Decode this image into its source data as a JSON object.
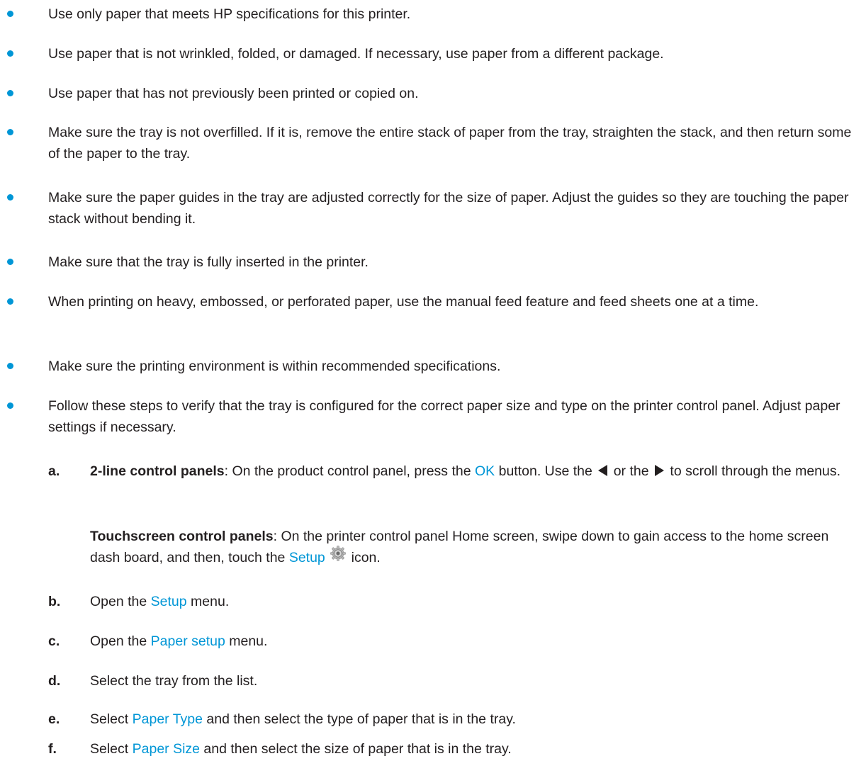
{
  "bullets": [
    "Use only paper that meets HP specifications for this printer.",
    "Use paper that is not wrinkled, folded, or damaged. If necessary, use paper from a different package.",
    "Use paper that has not previously been printed or copied on.",
    "Make sure the tray is not overfilled. If it is, remove the entire stack of paper from the tray, straighten the stack, and then return some of the paper to the tray.",
    "Make sure the paper guides in the tray are adjusted correctly for the size of paper. Adjust the guides so they are touching the paper stack without bending it.",
    "Make sure that the tray is fully inserted in the printer.",
    "When printing on heavy, embossed, or perforated paper, use the manual feed feature and feed sheets one at a time.",
    "Make sure the printing environment is within recommended specifications.",
    "Follow these steps to verify that the tray is configured for the correct paper size and type on the printer control panel. Adjust paper settings if necessary."
  ],
  "steps": {
    "a": {
      "letter": "a.",
      "twoline_label": "2-line control panels",
      "twoline_text1": ": On the product control panel, press the ",
      "ok": "OK",
      "twoline_text2": " button. Use the ",
      "twoline_text3": " or the ",
      "twoline_text4": " to scroll through the menus.",
      "touch_label": "Touchscreen control panels",
      "touch_text1": ": On the printer control panel Home screen, swipe down to gain access to the home screen dash board, and then, touch the ",
      "setup": "Setup",
      "touch_text2": " icon."
    },
    "b": {
      "letter": "b.",
      "pre": "Open the ",
      "link": "Setup",
      "post": " menu."
    },
    "c": {
      "letter": "c.",
      "pre": "Open the ",
      "link": "Paper setup",
      "post": " menu."
    },
    "d": {
      "letter": "d.",
      "text": "Select the tray from the list."
    },
    "e": {
      "letter": "e.",
      "pre": "Select ",
      "link": "Paper Type",
      "post": " and then select the type of paper that is in the tray."
    },
    "f": {
      "letter": "f.",
      "pre": "Select ",
      "link": "Paper Size",
      "post": " and then select the size of paper that is in the tray."
    }
  },
  "colors": {
    "accent": "#0096d6",
    "text": "#231f20"
  },
  "icons": [
    "left-arrow-icon",
    "right-arrow-icon",
    "setup-gear-icon"
  ]
}
